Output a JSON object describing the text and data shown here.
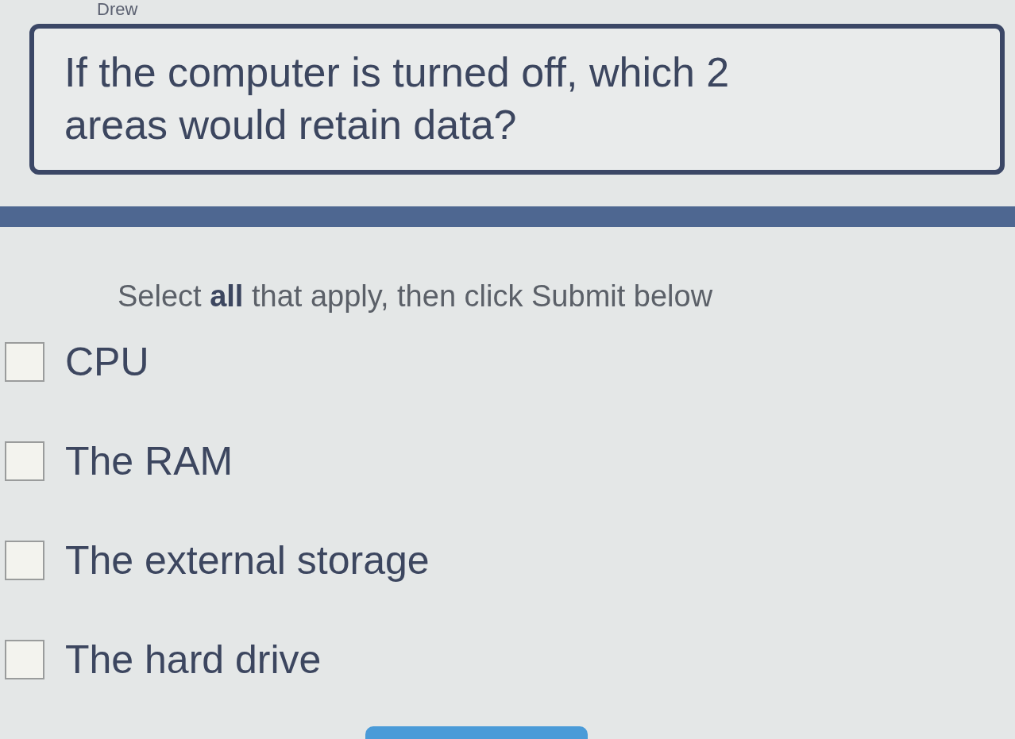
{
  "header": {
    "name": "Drew"
  },
  "question": {
    "text": "If the computer is turned off, which 2 areas would retain data?"
  },
  "instruction": "Select **all** that apply, then click Submit below",
  "options": [
    {
      "label": "CPU",
      "checked": false
    },
    {
      "label": "The RAM",
      "checked": false
    },
    {
      "label": "The external storage",
      "checked": false
    },
    {
      "label": "The hard drive",
      "checked": false
    }
  ]
}
